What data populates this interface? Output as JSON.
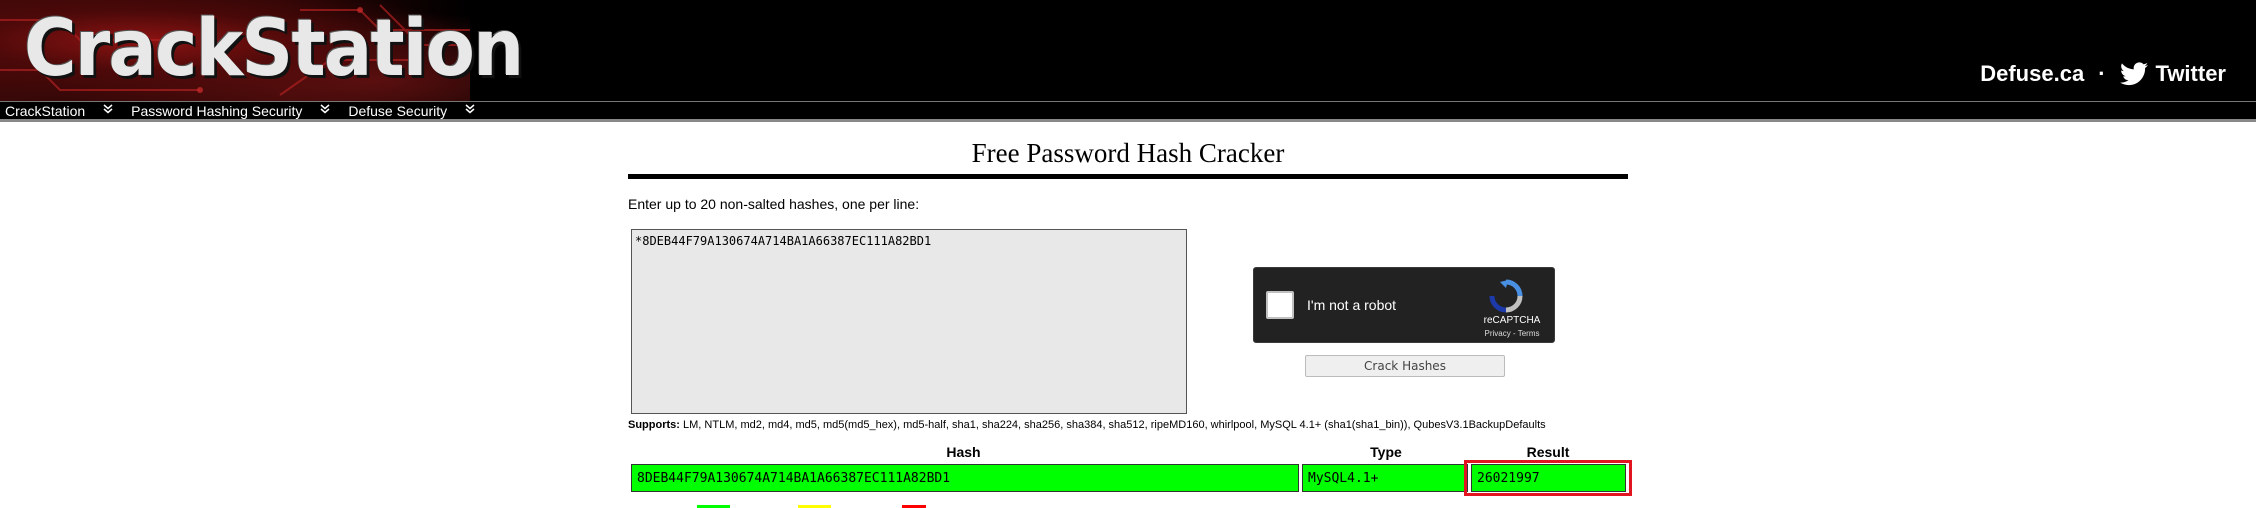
{
  "header": {
    "logo_text": "CrackStation",
    "right_link": "Defuse.ca",
    "separator": "·",
    "twitter_label": "Twitter"
  },
  "nav": {
    "items": [
      {
        "label": "CrackStation"
      },
      {
        "label": "Password Hashing Security"
      },
      {
        "label": "Defuse Security"
      }
    ],
    "chevron": "»"
  },
  "main": {
    "title": "Free Password Hash Cracker",
    "instruction": "Enter up to 20 non-salted hashes, one per line:",
    "hash_input_value": "*8DEB44F79A130674A714BA1A66387EC111A82BD1",
    "recaptcha": {
      "label": "I'm not a robot",
      "brand": "reCAPTCHA",
      "links": "Privacy - Terms"
    },
    "crack_button": "Crack Hashes",
    "supports_label": "Supports:",
    "supports_list": "LM, NTLM, md2, md4, md5, md5(md5_hex), md5-half, sha1, sha224, sha256, sha384, sha512, ripeMD160, whirlpool, MySQL 4.1+ (sha1(sha1_bin)), QubesV3.1BackupDefaults"
  },
  "results": {
    "headers": {
      "hash": "Hash",
      "type": "Type",
      "result": "Result"
    },
    "rows": [
      {
        "hash": "8DEB44F79A130674A714BA1A66387EC111A82BD1",
        "type": "MySQL4.1+",
        "result": "26021997",
        "status_color": "#00ff00"
      }
    ],
    "legend_colors": [
      "#00ff00",
      "#ffff00",
      "#ff0000"
    ]
  },
  "colors": {
    "header_bg": "#000000",
    "success": "#00ff00",
    "highlight": "#e0151f"
  }
}
